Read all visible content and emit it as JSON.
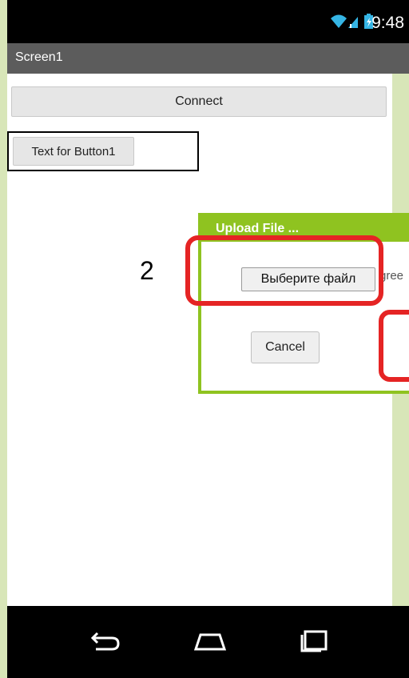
{
  "status_bar": {
    "time": "9:48"
  },
  "app": {
    "title": "Screen1"
  },
  "screen": {
    "connect_label": "Connect",
    "button1_label": "Text for Button1"
  },
  "dialog": {
    "title": "Upload File ...",
    "choose_label": "Выберите файл",
    "file_name_partial": "gree",
    "cancel_label": "Cancel"
  },
  "annotation": {
    "step": "2"
  },
  "icons": [
    "wifi-icon",
    "cell-signal-icon",
    "battery-icon",
    "back-icon",
    "home-icon",
    "recent-apps-icon"
  ],
  "colors": {
    "accent": "#8fc320",
    "highlight": "#e52424",
    "background": "#d8e6b8"
  }
}
